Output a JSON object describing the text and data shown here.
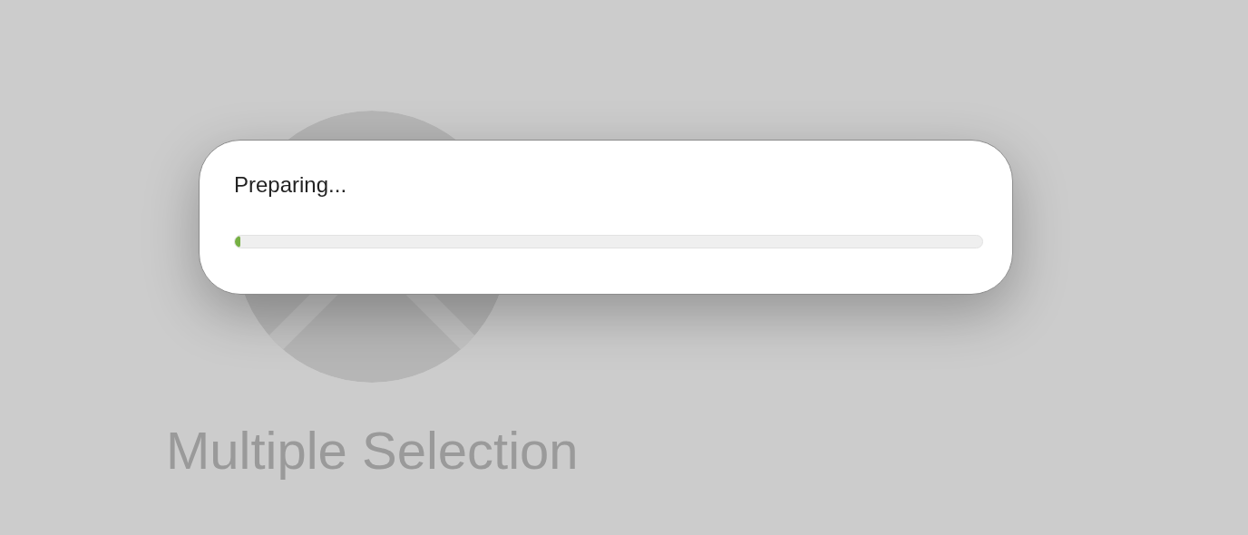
{
  "background": {
    "label": "Multiple Selection"
  },
  "dialog": {
    "message": "Preparing...",
    "progress": {
      "level": 0.007
    }
  }
}
